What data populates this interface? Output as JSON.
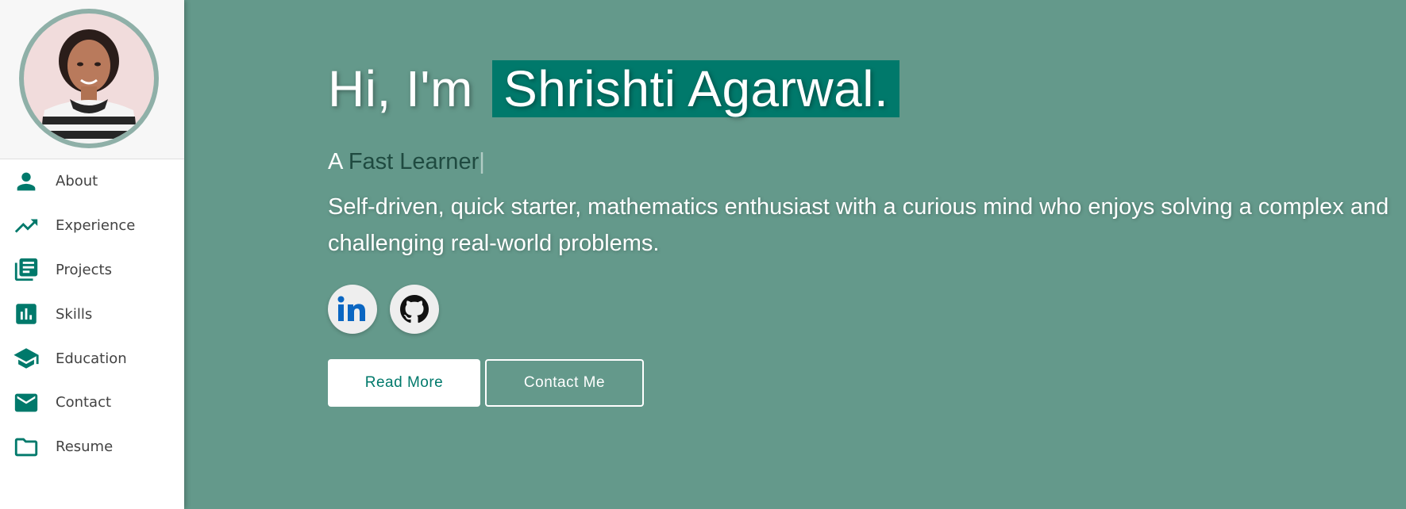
{
  "colors": {
    "hero_background": "#64998b",
    "accent": "#00796b",
    "sidebar_background": "#ffffff",
    "avatar_ring": "#8fb0a8"
  },
  "sidebar": {
    "items": [
      {
        "label": "About",
        "icon": "person-icon"
      },
      {
        "label": "Experience",
        "icon": "trending-up-icon"
      },
      {
        "label": "Projects",
        "icon": "library-books-icon"
      },
      {
        "label": "Skills",
        "icon": "bar-chart-icon"
      },
      {
        "label": "Education",
        "icon": "school-icon"
      },
      {
        "label": "Contact",
        "icon": "mail-icon"
      },
      {
        "label": "Resume",
        "icon": "folder-icon"
      }
    ]
  },
  "hero": {
    "greeting": "Hi, I'm",
    "name": "Shrishti Agarwal.",
    "tagline_prefix": "A",
    "tagline_highlight": "Fast Learner",
    "tagline_cursor": "|",
    "bio": "Self-driven, quick starter, mathematics enthusiast with a curious mind who enjoys solving a complex and challenging real-world problems.",
    "socials": [
      {
        "icon": "linkedin-icon"
      },
      {
        "icon": "github-icon"
      }
    ],
    "buttons": {
      "read_more": "Read More",
      "contact_me": "Contact Me"
    }
  }
}
